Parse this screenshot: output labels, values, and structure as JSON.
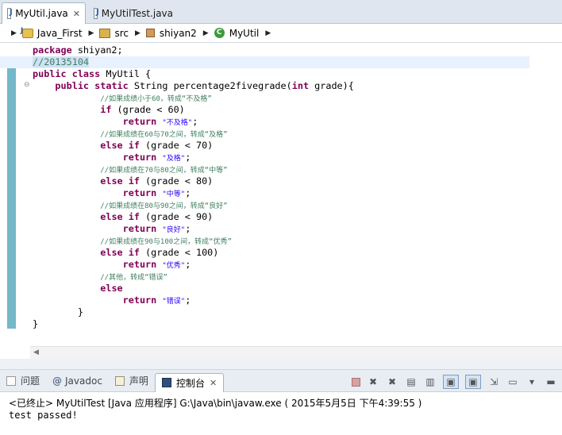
{
  "tabs": [
    {
      "label": "MyUtil.java",
      "close": "✕"
    },
    {
      "label": "MyUtilTest.java"
    }
  ],
  "breadcrumb": [
    "Java_First",
    "src",
    "shiyan2",
    "MyUtil"
  ],
  "code": {
    "l1_kw": "package",
    "l1_rest": " shiyan2;",
    "l2": "//20135104",
    "l3_kw": "public class",
    "l3_rest": " MyUtil {",
    "l4_kw1": "public static",
    "l4_mid": " String percentage2fivegrade(",
    "l4_kw2": "int",
    "l4_end": " grade){",
    "c1": "//如果成绩小于60，转成“不及格”",
    "if_kw": "if",
    "if_rest": " (grade < 60)",
    "ret_kw": "return",
    "r1": "\"不及格\"",
    "c2": "//如果成绩在60与70之间，转成“及格”",
    "elseif_kw": "else if",
    "e1": " (grade < 70)",
    "r2": "\"及格\"",
    "c3": "//如果成绩在70与80之间，转成“中等”",
    "e2": " (grade < 80)",
    "r3": "\"中等\"",
    "c4": "//如果成绩在80与90之间，转成“良好”",
    "e3": " (grade < 90)",
    "r4": "\"良好\"",
    "c5": "//如果成绩在90与100之间，转成“优秀”",
    "e4": " (grade < 100)",
    "r5": "\"优秀\"",
    "c6": "//其他，转成“错误”",
    "else_kw": "else",
    "r6": "\"错误\"",
    "semi": ";",
    "close_inner": "}",
    "close_outer": "}"
  },
  "views": {
    "problems": "问题",
    "javadoc": "Javadoc",
    "declaration": "声明",
    "console": "控制台",
    "console_close": "✕"
  },
  "console": {
    "title": "<已终止> MyUtilTest [Java 应用程序] G:\\Java\\bin\\javaw.exe ( 2015年5月5日 下午4:39:55 )",
    "output": "test passed!"
  }
}
